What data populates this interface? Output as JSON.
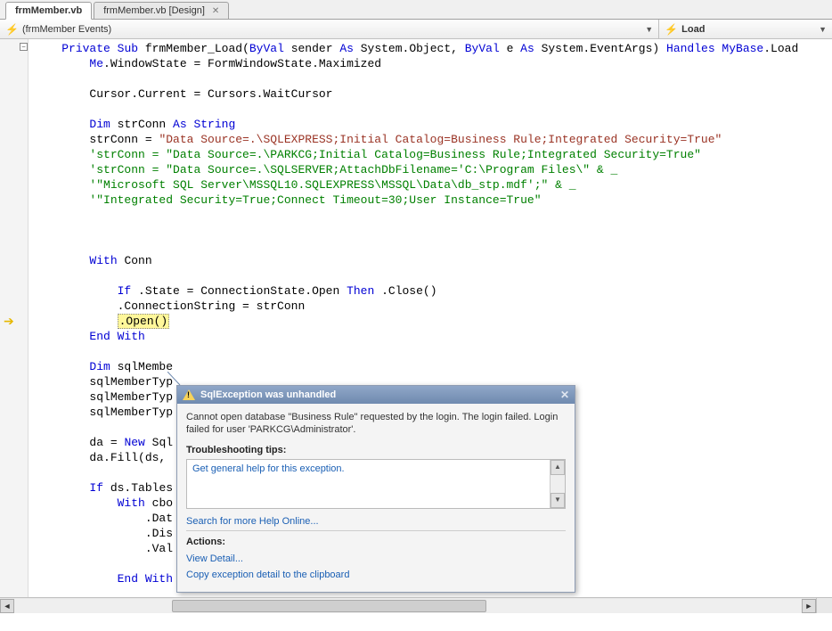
{
  "tabs": [
    {
      "label": "frmMember.vb",
      "active": true
    },
    {
      "label": "frmMember.vb [Design]",
      "active": false
    }
  ],
  "dropdowns": {
    "left": "(frmMember Events)",
    "right": "Load"
  },
  "code": {
    "l1_a": "Private",
    "l1_b": "Sub",
    "l1_c": " frmMember_Load(",
    "l1_d": "ByVal",
    "l1_e": " sender ",
    "l1_f": "As",
    "l1_g": " System.Object, ",
    "l1_h": "ByVal",
    "l1_i": " e ",
    "l1_j": "As",
    "l1_k": " System.EventArgs) ",
    "l1_l": "Handles",
    "l1_m": " MyBase",
    "l1_n": ".Load",
    "l2_a": "Me",
    "l2_b": ".WindowState = FormWindowState.Maximized",
    "l4": "Cursor.Current = Cursors.WaitCursor",
    "l6_a": "Dim",
    "l6_b": " strConn ",
    "l6_c": "As",
    "l6_d": " String",
    "l7_a": "strConn = ",
    "l7_b": "\"Data Source=.\\SQLEXPRESS;Initial Catalog=Business Rule;Integrated Security=True\"",
    "l8": "'strConn = \"Data Source=.\\PARKCG;Initial Catalog=Business Rule;Integrated Security=True\"",
    "l9": "'strConn = \"Data Source=.\\SQLSERVER;AttachDbFilename='C:\\Program Files\\\" & _",
    "l10": "'\"Microsoft SQL Server\\MSSQL10.SQLEXPRESS\\MSSQL\\Data\\db_stp.mdf';\" & _",
    "l11": "'\"Integrated Security=True;Connect Timeout=30;User Instance=True\"",
    "l15_a": "With",
    "l15_b": " Conn",
    "l17_a": "If",
    "l17_b": " .State = ConnectionState.Open ",
    "l17_c": "Then",
    "l17_d": " .Close()",
    "l18": ".ConnectionString = strConn",
    "l19": ".Open()",
    "l20_a": "End",
    "l20_b": " With",
    "l22_a": "Dim",
    "l22_b": " sqlMembe",
    "l23": "sqlMemberTyp",
    "l24": "sqlMemberTyp",
    "l25": "sqlMemberTyp",
    "l27_a": "da = ",
    "l27_b": "New",
    "l27_c": " Sql",
    "l28": "da.Fill(ds, ",
    "l30_a": "If",
    "l30_b": " ds.Tables",
    "l31_a": "With",
    "l31_b": " cbo",
    "l32": ".Dat",
    "l33": ".Dis",
    "l34": ".Val",
    "l36_a": "End",
    "l36_b": " With"
  },
  "exception": {
    "title": "SqlException was unhandled",
    "message": "Cannot open database \"Business Rule\" requested by the login. The login failed. Login failed for user 'PARKCG\\Administrator'.",
    "tips_label": "Troubleshooting tips:",
    "tip1": "Get general help for this exception.",
    "search_link": "Search for more Help Online...",
    "actions_label": "Actions:",
    "view_detail": "View Detail...",
    "copy_detail": "Copy exception detail to the clipboard"
  }
}
